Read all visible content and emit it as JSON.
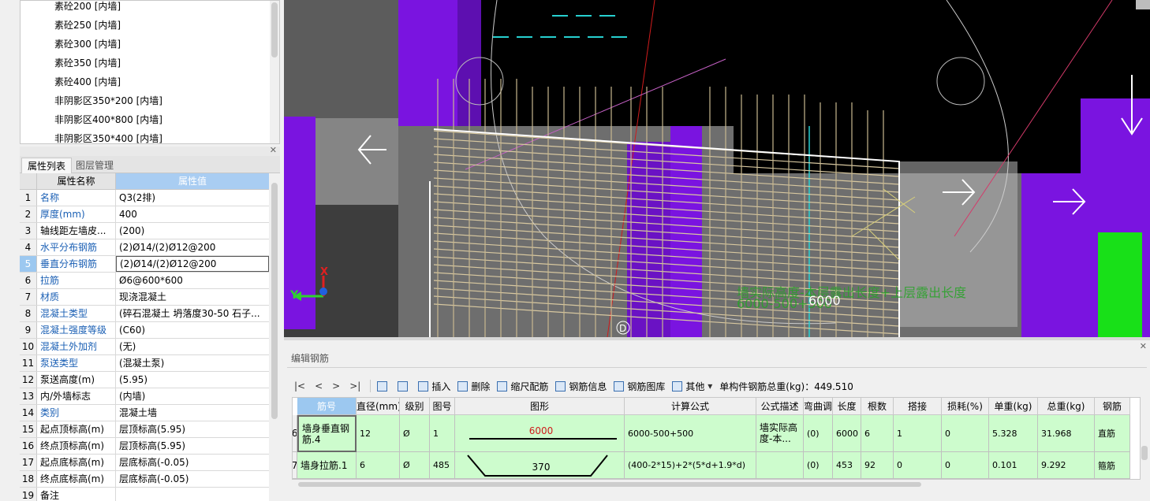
{
  "tree": {
    "items": [
      "素砼200 [内墙]",
      "素砼250 [内墙]",
      "素砼300 [内墙]",
      "素砼350 [内墙]",
      "素砼400 [内墙]",
      "非阴影区350*200 [内墙]",
      "非阴影区400*800 [内墙]",
      "非阴影区350*400 [内墙]"
    ]
  },
  "tabs": {
    "props": "属性列表",
    "layers": "图层管理"
  },
  "props": {
    "header": {
      "name": "属性名称",
      "value": "属性值"
    },
    "rows": [
      {
        "num": "1",
        "name": "名称",
        "value": "Q3(2排)",
        "link": true
      },
      {
        "num": "2",
        "name": "厚度(mm)",
        "value": "400",
        "link": true
      },
      {
        "num": "3",
        "name": "轴线距左墙皮...",
        "value": "(200)",
        "link": false
      },
      {
        "num": "4",
        "name": "水平分布钢筋",
        "value": "(2)Ø14/(2)Ø12@200",
        "link": true
      },
      {
        "num": "5",
        "name": "垂直分布钢筋",
        "value": "(2)Ø14/(2)Ø12@200",
        "link": true,
        "selected": true
      },
      {
        "num": "6",
        "name": "拉筋",
        "value": "Ø6@600*600",
        "link": true
      },
      {
        "num": "7",
        "name": "材质",
        "value": "现浇混凝土",
        "link": true
      },
      {
        "num": "8",
        "name": "混凝土类型",
        "value": "(碎石混凝土 坍落度30-50 石子...",
        "link": true
      },
      {
        "num": "9",
        "name": "混凝土强度等级",
        "value": "(C60)",
        "link": true
      },
      {
        "num": "10",
        "name": "混凝土外加剂",
        "value": "(无)",
        "link": true
      },
      {
        "num": "11",
        "name": "泵送类型",
        "value": "(混凝土泵)",
        "link": true
      },
      {
        "num": "12",
        "name": "泵送高度(m)",
        "value": "(5.95)",
        "link": false
      },
      {
        "num": "13",
        "name": "内/外墙标志",
        "value": "(内墙)",
        "link": false
      },
      {
        "num": "14",
        "name": "类别",
        "value": "混凝土墙",
        "link": true
      },
      {
        "num": "15",
        "name": "起点顶标高(m)",
        "value": "层顶标高(5.95)",
        "link": false
      },
      {
        "num": "16",
        "name": "终点顶标高(m)",
        "value": "层顶标高(5.95)",
        "link": false
      },
      {
        "num": "17",
        "name": "起点底标高(m)",
        "value": "层底标高(-0.05)",
        "link": false
      },
      {
        "num": "18",
        "name": "终点底标高(m)",
        "value": "层底标高(-0.05)",
        "link": false
      },
      {
        "num": "19",
        "name": "备注",
        "value": "",
        "link": false
      }
    ]
  },
  "viewport": {
    "dim_label": "墙实际高度-本层露出长度+上层露出长度",
    "dim_formula": "6000-500+500",
    "dim_value": "6000",
    "axis_x": "X",
    "axis_y": "Y",
    "point_label": "D"
  },
  "edit_rebar": {
    "title": "编辑钢筋",
    "toolbar": {
      "nav": [
        "|<",
        "<",
        ">",
        ">|"
      ],
      "insert": "插入",
      "delete": "删除",
      "scale": "缩尺配筋",
      "info": "钢筋信息",
      "library": "钢筋图库",
      "other": "其他",
      "total_label": "单构件钢筋总重(kg)：449.510"
    },
    "columns": [
      "筋号",
      "直径(mm)",
      "级别",
      "图号",
      "图形",
      "计算公式",
      "公式描述",
      "弯曲调整",
      "长度",
      "根数",
      "搭接",
      "损耗(%)",
      "单重(kg)",
      "总重(kg)",
      "钢筋"
    ],
    "rows": [
      {
        "num": "6",
        "name": "墙身垂直钢筋.4",
        "dia": "12",
        "grade": "Ø",
        "fig": "1",
        "shape_value": "6000",
        "formula": "6000-500+500",
        "desc": "墙实际高度-本...",
        "bend": "(0)",
        "length": "6000",
        "count": "6",
        "lap": "1",
        "loss": "0",
        "unit_w": "5.328",
        "total_w": "31.968",
        "type": "直筋"
      },
      {
        "num": "7",
        "name": "墙身拉筋.1",
        "dia": "6",
        "grade": "Ø",
        "fig": "485",
        "shape_value": "370",
        "formula": "(400-2*15)+2*(5*d+1.9*d)",
        "desc": "",
        "bend": "(0)",
        "length": "453",
        "count": "92",
        "lap": "0",
        "loss": "0",
        "unit_w": "0.101",
        "total_w": "9.292",
        "type": "箍筋"
      }
    ]
  }
}
